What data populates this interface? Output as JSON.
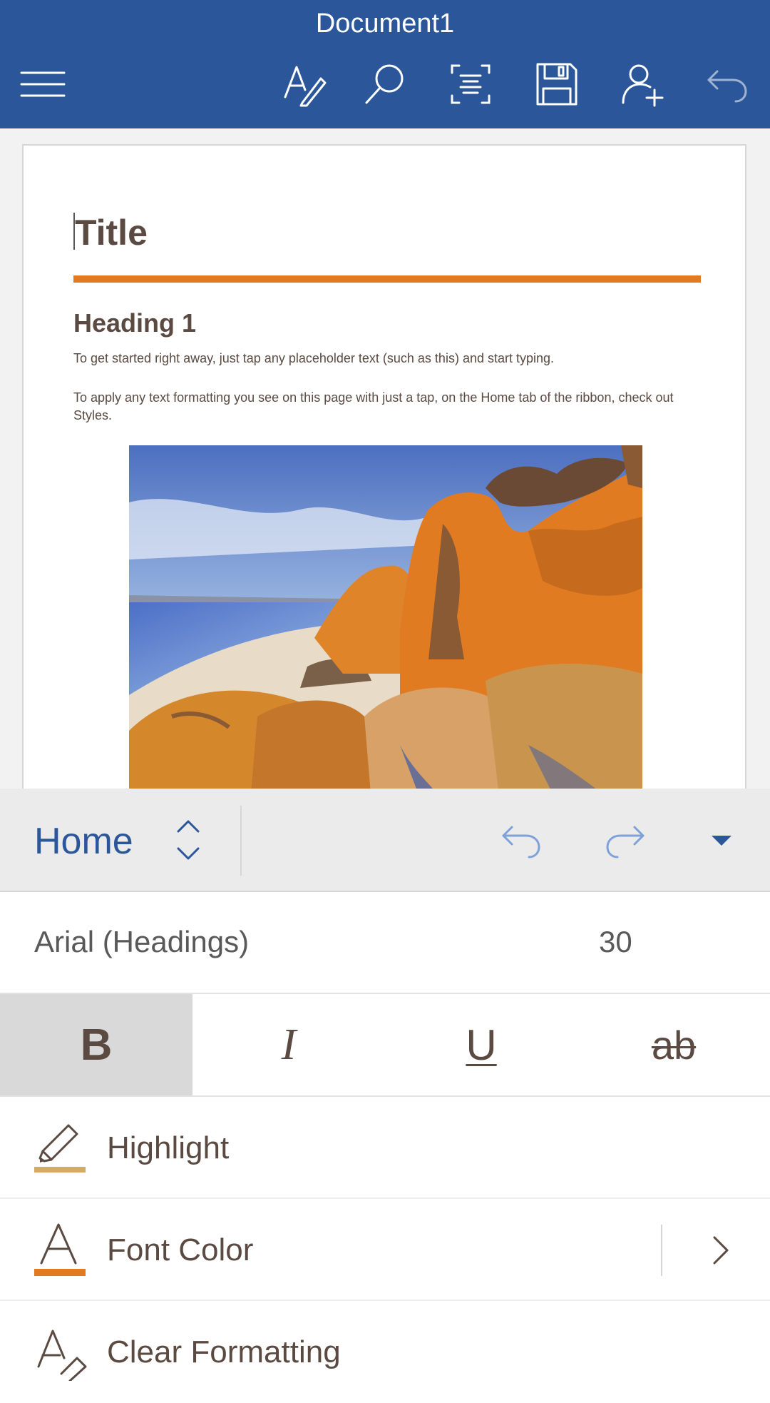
{
  "header": {
    "title": "Document1",
    "icons": [
      "menu-icon",
      "draw-pen-icon",
      "search-icon",
      "focus-view-icon",
      "save-icon",
      "share-add-person-icon",
      "undo-icon"
    ],
    "background": "#2b579a"
  },
  "document": {
    "title": "Title",
    "heading": "Heading 1",
    "paragraphs": [
      "To get started right away, just tap any placeholder text (such as this) and start typing.",
      "To apply any text formatting you see on this page with just a tap, on the Home tab of the ribbon, check out Styles."
    ],
    "accent_color": "#e07b22",
    "text_color": "#5a4a42"
  },
  "ribbon": {
    "tab_label": "Home",
    "icons": [
      "tab-switch-icon",
      "undo-icon",
      "redo-icon",
      "collapse-ribbon-icon"
    ]
  },
  "format_panel": {
    "font_name": "Arial (Headings)",
    "font_size": "30",
    "styles": [
      {
        "label": "B",
        "active": true
      },
      {
        "label": "I",
        "active": false
      },
      {
        "label": "U",
        "active": false
      },
      {
        "label": "ab",
        "active": false
      }
    ],
    "rows": [
      {
        "label": "Highlight",
        "icon": "highlighter-icon",
        "swatch": "#d9a867"
      },
      {
        "label": "Font Color",
        "icon": "font-color-icon",
        "swatch": "#e07b22"
      },
      {
        "label": "Clear Formatting",
        "icon": "clear-formatting-icon"
      }
    ]
  }
}
